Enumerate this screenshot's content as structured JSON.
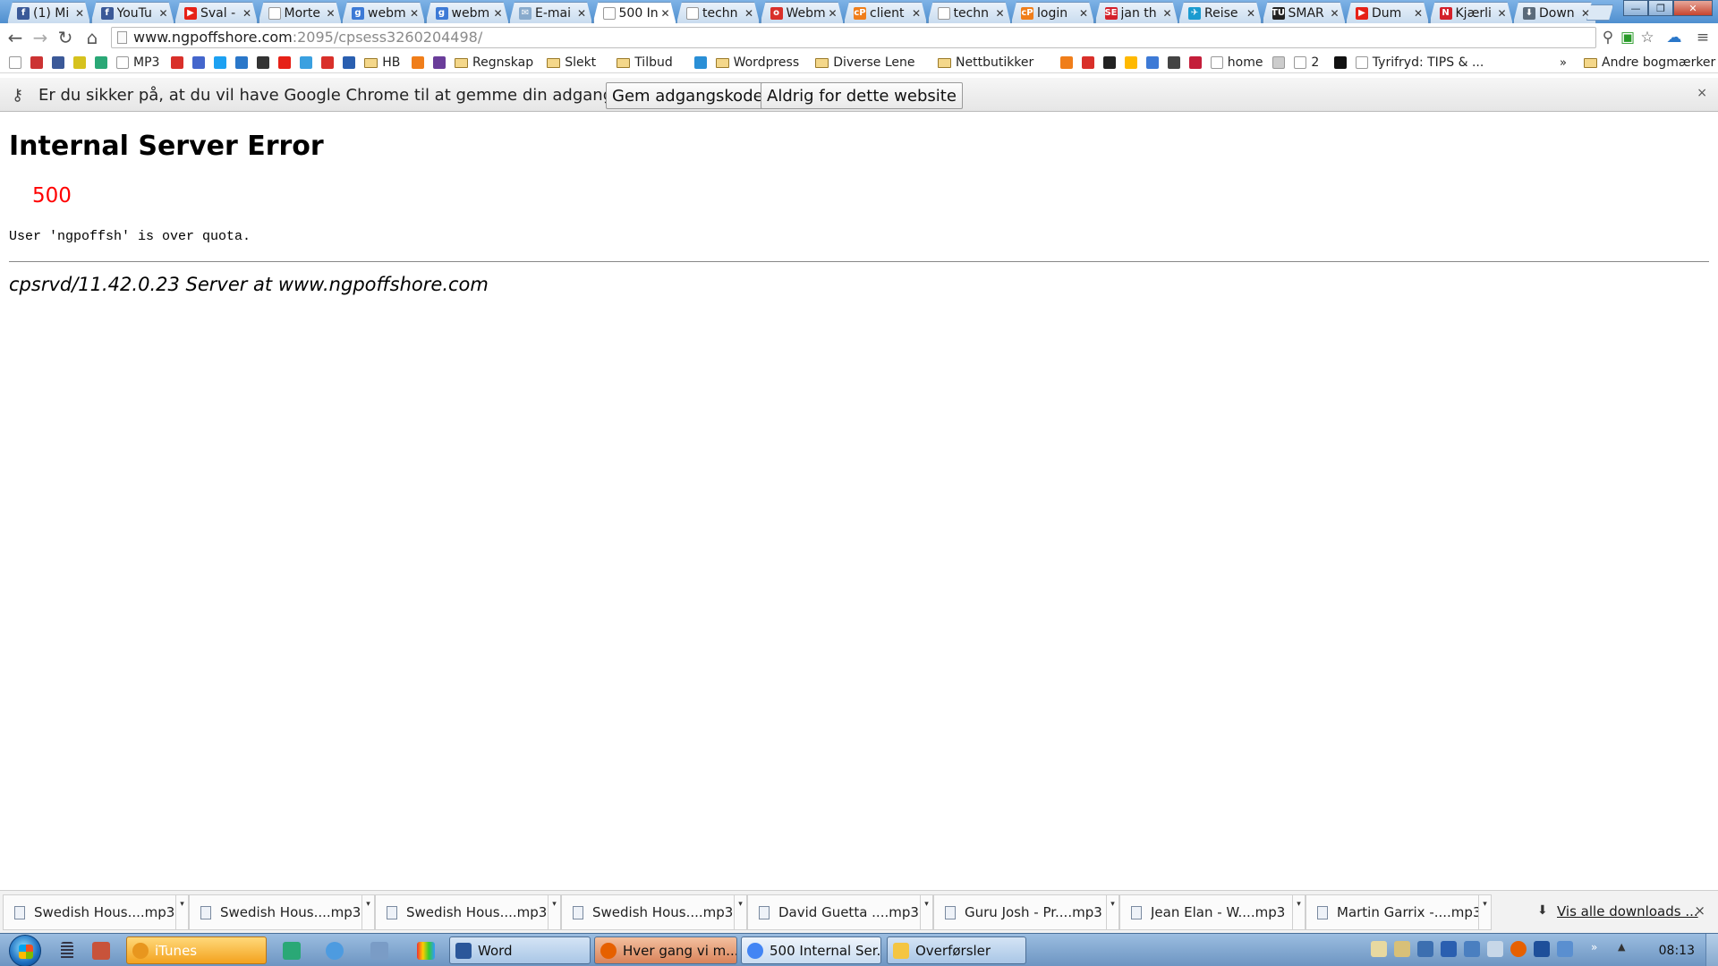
{
  "browser": {
    "tabs": [
      {
        "label": "(1) Mi",
        "favicon": "facebook-icon",
        "color": "#3b5998",
        "glyph": "f"
      },
      {
        "label": "YouTu",
        "favicon": "facebook-icon",
        "color": "#3b5998",
        "glyph": "f"
      },
      {
        "label": "Sval -",
        "favicon": "youtube-icon",
        "color": "#e62117",
        "glyph": "▶"
      },
      {
        "label": "Morte",
        "favicon": "page-icon",
        "color": "#ffffff",
        "glyph": ""
      },
      {
        "label": "webm",
        "favicon": "gmail-icon",
        "color": "#3d7ad6",
        "glyph": "g"
      },
      {
        "label": "webm",
        "favicon": "gmail-icon",
        "color": "#3d7ad6",
        "glyph": "g"
      },
      {
        "label": "E-mai",
        "favicon": "mail-icon",
        "color": "#88aacc",
        "glyph": "✉"
      },
      {
        "label": "500 In",
        "favicon": "page-icon",
        "color": "#ffffff",
        "glyph": "",
        "active": true
      },
      {
        "label": "techn",
        "favicon": "page-icon",
        "color": "#ffffff",
        "glyph": ""
      },
      {
        "label": "Webm",
        "favicon": "opera-icon",
        "color": "#d9302a",
        "glyph": "o"
      },
      {
        "label": "client",
        "favicon": "cpanel-icon",
        "color": "#f07e1a",
        "glyph": "cP"
      },
      {
        "label": "techn",
        "favicon": "page-icon",
        "color": "#ffffff",
        "glyph": ""
      },
      {
        "label": "login",
        "favicon": "cpanel-icon",
        "color": "#f07e1a",
        "glyph": "cP"
      },
      {
        "label": "jan th",
        "favicon": "se-icon",
        "color": "#d4202a",
        "glyph": "SE"
      },
      {
        "label": "Reise",
        "favicon": "travel-icon",
        "color": "#1a9bd0",
        "glyph": "✈"
      },
      {
        "label": "SMAR",
        "favicon": "tu-icon",
        "color": "#222222",
        "glyph": "TU"
      },
      {
        "label": "Dum",
        "favicon": "youtube-icon",
        "color": "#e62117",
        "glyph": "▶"
      },
      {
        "label": "Kjærli",
        "favicon": "n-icon",
        "color": "#d4202a",
        "glyph": "N"
      },
      {
        "label": "Down",
        "favicon": "download-icon",
        "color": "#5a6a7a",
        "glyph": "⬇"
      }
    ],
    "window_controls": {
      "minimize": "—",
      "maximize": "❐",
      "close": "✕"
    },
    "address_bar": {
      "host": "www.ngpoffshore.com",
      "path": ":2095/cpsess3260204498/"
    },
    "bookmarks": [
      {
        "label": "",
        "type": "icon",
        "color": "#ffffff"
      },
      {
        "label": "",
        "type": "icon",
        "color": "#cc3333"
      },
      {
        "label": "",
        "type": "icon",
        "color": "#3b5998"
      },
      {
        "label": "",
        "type": "icon",
        "color": "#d6c21e"
      },
      {
        "label": "",
        "type": "icon",
        "color": "#2aa876"
      },
      {
        "label": "MP3",
        "type": "page",
        "color": "#ffffff"
      },
      {
        "label": "",
        "type": "icon",
        "color": "#d9302a"
      },
      {
        "label": "",
        "type": "icon",
        "color": "#4466cc"
      },
      {
        "label": "",
        "type": "icon",
        "color": "#1da1f2"
      },
      {
        "label": "",
        "type": "icon",
        "color": "#2a77c9"
      },
      {
        "label": "",
        "type": "icon",
        "color": "#333333"
      },
      {
        "label": "",
        "type": "icon",
        "color": "#e62117"
      },
      {
        "label": "",
        "type": "icon",
        "color": "#3aa0e0"
      },
      {
        "label": "",
        "type": "icon",
        "color": "#d9302a"
      },
      {
        "label": "",
        "type": "icon",
        "color": "#2a5fb0"
      },
      {
        "label": "HB",
        "type": "folder",
        "color": "#f4d78a"
      },
      {
        "label": "",
        "type": "icon",
        "color": "#f07e1a"
      },
      {
        "label": "",
        "type": "icon",
        "color": "#6a3d9a"
      },
      {
        "label": "Regnskap",
        "type": "folder",
        "color": "#f4d78a"
      },
      {
        "label": "Slekt",
        "type": "folder",
        "color": "#f4d78a"
      },
      {
        "label": "Tilbud",
        "type": "folder",
        "color": "#f4d78a"
      },
      {
        "label": "",
        "type": "icon",
        "color": "#2a8fd6"
      },
      {
        "label": "Wordpress",
        "type": "folder",
        "color": "#f4d78a"
      },
      {
        "label": "Diverse Lene",
        "type": "folder",
        "color": "#f4d78a"
      },
      {
        "label": "Nettbutikker",
        "type": "folder",
        "color": "#f4d78a"
      },
      {
        "label": "",
        "type": "icon",
        "color": "#f07e1a"
      },
      {
        "label": "",
        "type": "icon",
        "color": "#d9302a"
      },
      {
        "label": "",
        "type": "icon",
        "color": "#222222"
      },
      {
        "label": "",
        "type": "icon",
        "color": "#ffb900"
      },
      {
        "label": "",
        "type": "icon",
        "color": "#3d7ad6"
      },
      {
        "label": "",
        "type": "icon",
        "color": "#444444"
      },
      {
        "label": "",
        "type": "icon",
        "color": "#c41e3a"
      },
      {
        "label": "home",
        "type": "icon",
        "color": "#ffffff"
      },
      {
        "label": "",
        "type": "icon",
        "color": "#cccccc"
      },
      {
        "label": "2",
        "type": "icon",
        "color": "#ffffff"
      },
      {
        "label": "",
        "type": "icon",
        "color": "#111111"
      },
      {
        "label": "Tyrifryd: TIPS & ...",
        "type": "page",
        "color": "#ffffff"
      }
    ],
    "bookmarks_overflow": "»",
    "other_bookmarks": "Andre bogmærker",
    "infobar": {
      "message": "Er du sikker på, at du vil have Google Chrome til at gemme din adgangskode?",
      "save_button": "Gem adgangskode",
      "never_button": "Aldrig for dette website",
      "close": "×"
    }
  },
  "page": {
    "heading": "Internal Server Error",
    "status_code": "500",
    "detail": "User 'ngpoffsh' is over quota.",
    "signature": "cpsrvd/11.42.0.23 Server at www.ngpoffshore.com"
  },
  "downloads": {
    "items": [
      "Swedish Hous....mp3",
      "Swedish Hous....mp3",
      "Swedish Hous....mp3",
      "Swedish Hous....mp3",
      "David Guetta ....mp3",
      "Guru Josh - Pr....mp3",
      "Jean Elan - W....mp3",
      "Martin Garrix -....mp3"
    ],
    "show_all": "Vis alle downloads ...",
    "close": "×"
  },
  "taskbar": {
    "tasks": [
      {
        "label": "iTunes",
        "kind": "itunes",
        "color": "#e8961e"
      },
      {
        "label": "Word",
        "kind": "word",
        "color": "#2b579a"
      },
      {
        "label": "Hver gang vi m...",
        "kind": "firefox",
        "color": "#e66000"
      },
      {
        "label": "500 Internal Ser...",
        "kind": "chrome",
        "color": "#4285f4"
      },
      {
        "label": "Overførsler",
        "kind": "explorer",
        "color": "#f4c542"
      }
    ],
    "clock": "08:13"
  }
}
